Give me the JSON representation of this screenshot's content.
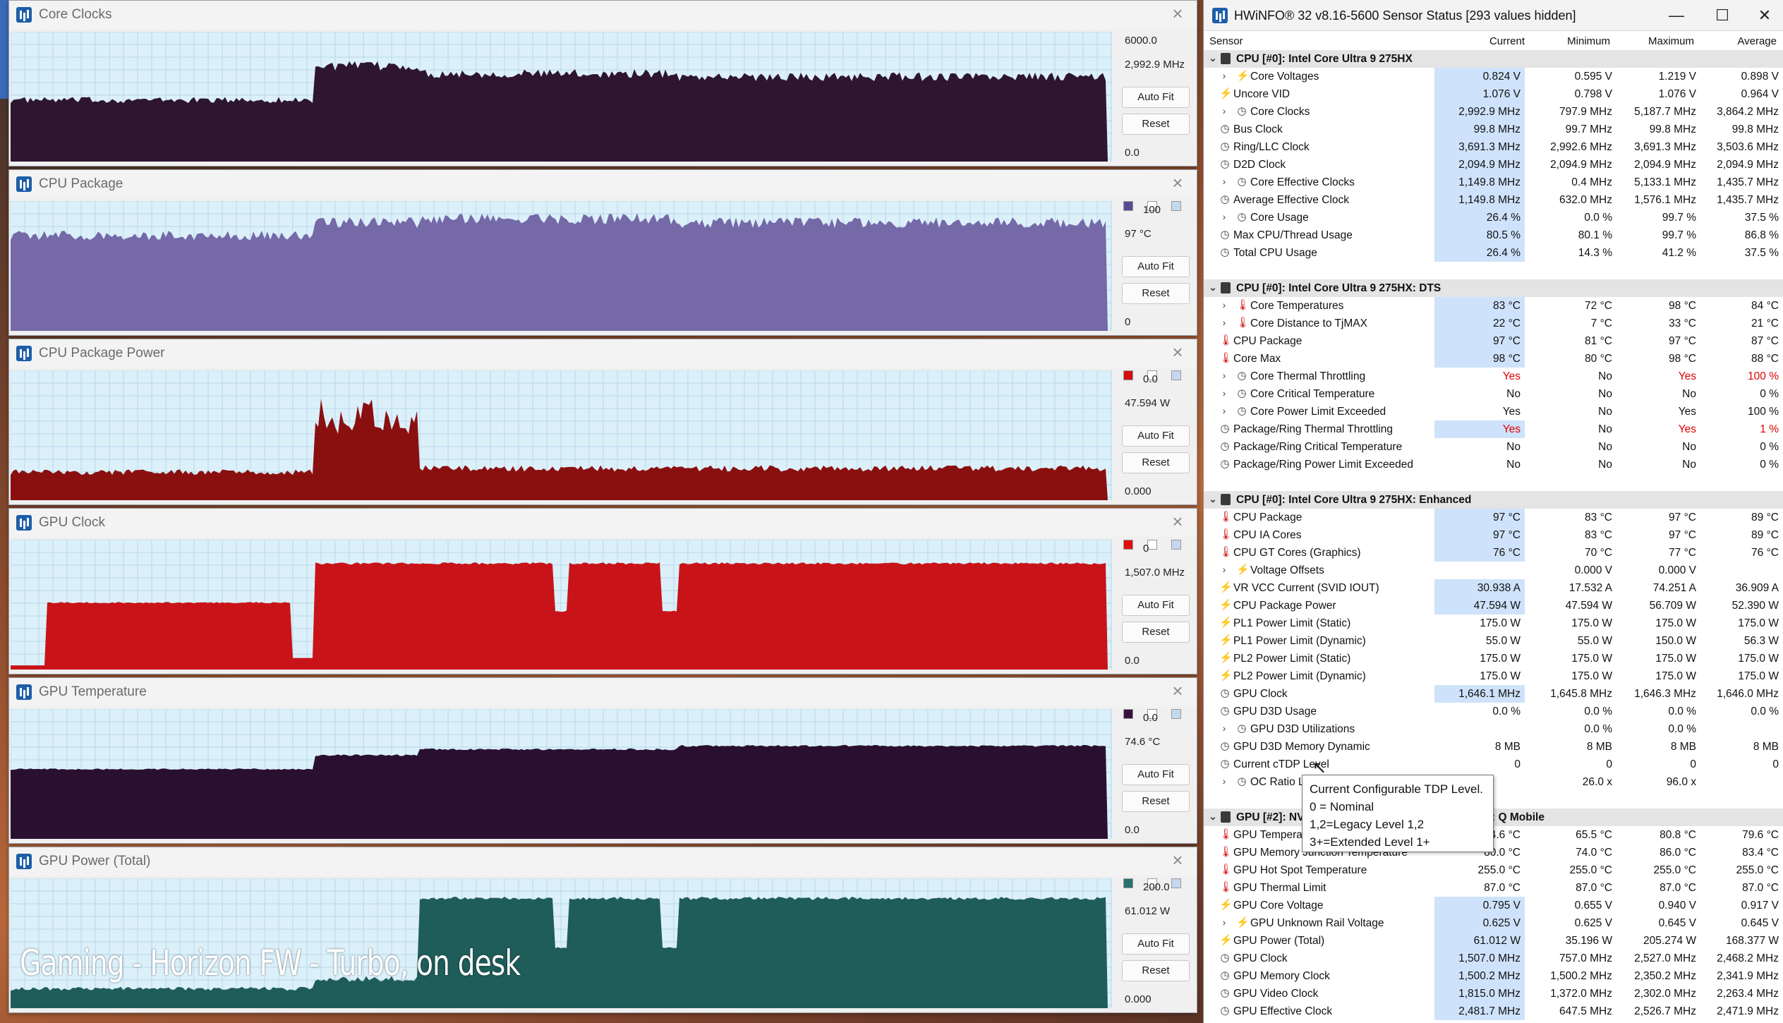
{
  "graphs": [
    {
      "title": "Core Clocks",
      "max": "6000.0",
      "current": "2,992.9 MHz",
      "min": "0.0",
      "auto_fit": "Auto Fit",
      "reset": "Reset",
      "color": "#2e1530",
      "sw": []
    },
    {
      "title": "CPU Package",
      "max": "100",
      "current": "97 °C",
      "min": "0",
      "auto_fit": "Auto Fit",
      "reset": "Reset",
      "color": "#7569a8",
      "sw": [
        "#5a4a90",
        "#ffffff",
        "#c6d8ef"
      ]
    },
    {
      "title": "CPU Package Power",
      "max": "0.0",
      "current": "47.594 W",
      "min": "0.000",
      "auto_fit": "Auto Fit",
      "reset": "Reset",
      "color": "#8a1010",
      "sw": [
        "#d01010",
        "#ffffff",
        "#c6d8ef"
      ]
    },
    {
      "title": "GPU Clock",
      "max": "0",
      "current": "1,507.0 MHz",
      "min": "0.0",
      "auto_fit": "Auto Fit",
      "reset": "Reset",
      "color": "#c81418",
      "sw": [
        "#e01010",
        "#ffffff",
        "#c6d8ef"
      ]
    },
    {
      "title": "GPU Temperature",
      "max": "0.0",
      "current": "74.6 °C",
      "min": "0.0",
      "auto_fit": "Auto Fit",
      "reset": "Reset",
      "color": "#2a1030",
      "sw": [
        "#3a1040",
        "#ffffff",
        "#c6d8ef"
      ]
    },
    {
      "title": "GPU Power (Total)",
      "max": "200.0",
      "current": "61.012 W",
      "min": "0.000",
      "auto_fit": "Auto Fit",
      "reset": "Reset",
      "color": "#1f5d5a",
      "sw": [
        "#2a7070",
        "#ffffff",
        "#c6d8ef"
      ]
    }
  ],
  "chart_data": [
    {
      "type": "area",
      "title": "Core Clocks",
      "ylim": [
        0,
        6000
      ],
      "segments_y": [
        2900,
        4500,
        4150,
        4000
      ]
    },
    {
      "type": "area",
      "title": "CPU Package",
      "ylim": [
        0,
        100
      ],
      "segments_y": [
        75,
        85,
        88,
        85
      ]
    },
    {
      "type": "area",
      "title": "CPU Package Power",
      "ylim": [
        0,
        100
      ],
      "segments_y": [
        22,
        58,
        25,
        25
      ]
    },
    {
      "type": "area",
      "title": "GPU Clock",
      "ylim": [
        0,
        2800
      ],
      "segments_y": [
        1450,
        2300,
        2300,
        2300
      ]
    },
    {
      "type": "area",
      "title": "GPU Temperature",
      "ylim": [
        0,
        100
      ],
      "segments_y": [
        60,
        72,
        77,
        80
      ]
    },
    {
      "type": "area",
      "title": "GPU Power (Total)",
      "ylim": [
        0,
        200
      ],
      "segments_y": [
        30,
        45,
        200,
        200
      ]
    }
  ],
  "hwinfo": {
    "title": "HWiNFO® 32 v8.16-5600 Sensor Status [293 values hidden]",
    "columns": {
      "sensor": "Sensor",
      "current": "Current",
      "minimum": "Minimum",
      "maximum": "Maximum",
      "average": "Average"
    },
    "rows": [
      {
        "t": "g",
        "label": "CPU [#0]: Intel Core Ultra 9 275HX"
      },
      {
        "t": "r",
        "exp": 1,
        "icon": "bolt",
        "label": "Core Voltages",
        "cur": "0.824 V",
        "min": "0.595 V",
        "max": "1.219 V",
        "avg": "0.898 V",
        "hl": 1
      },
      {
        "t": "r",
        "icon": "bolt",
        "label": "Uncore VID",
        "cur": "1.076 V",
        "min": "0.798 V",
        "max": "1.076 V",
        "avg": "0.964 V",
        "hl": 1
      },
      {
        "t": "r",
        "exp": 1,
        "icon": "clock",
        "label": "Core Clocks",
        "cur": "2,992.9 MHz",
        "min": "797.9 MHz",
        "max": "5,187.7 MHz",
        "avg": "3,864.2 MHz",
        "hl": 1
      },
      {
        "t": "r",
        "icon": "clock",
        "label": "Bus Clock",
        "cur": "99.8 MHz",
        "min": "99.7 MHz",
        "max": "99.8 MHz",
        "avg": "99.8 MHz",
        "hl": 1
      },
      {
        "t": "r",
        "icon": "clock",
        "label": "Ring/LLC Clock",
        "cur": "3,691.3 MHz",
        "min": "2,992.6 MHz",
        "max": "3,691.3 MHz",
        "avg": "3,503.6 MHz",
        "hl": 1
      },
      {
        "t": "r",
        "icon": "clock",
        "label": "D2D Clock",
        "cur": "2,094.9 MHz",
        "min": "2,094.9 MHz",
        "max": "2,094.9 MHz",
        "avg": "2,094.9 MHz",
        "hl": 1
      },
      {
        "t": "r",
        "exp": 1,
        "icon": "clock",
        "label": "Core Effective Clocks",
        "cur": "1,149.8 MHz",
        "min": "0.4 MHz",
        "max": "5,133.1 MHz",
        "avg": "1,435.7 MHz",
        "hl": 1
      },
      {
        "t": "r",
        "icon": "clock",
        "label": "Average Effective Clock",
        "cur": "1,149.8 MHz",
        "min": "632.0 MHz",
        "max": "1,576.1 MHz",
        "avg": "1,435.7 MHz",
        "hl": 1
      },
      {
        "t": "r",
        "exp": 1,
        "icon": "clock",
        "label": "Core Usage",
        "cur": "26.4 %",
        "min": "0.0 %",
        "max": "99.7 %",
        "avg": "37.5 %",
        "hl": 1
      },
      {
        "t": "r",
        "icon": "clock",
        "label": "Max CPU/Thread Usage",
        "cur": "80.5 %",
        "min": "80.1 %",
        "max": "99.7 %",
        "avg": "86.8 %",
        "hl": 1
      },
      {
        "t": "r",
        "icon": "clock",
        "label": "Total CPU Usage",
        "cur": "26.4 %",
        "min": "14.3 %",
        "max": "41.2 %",
        "avg": "37.5 %",
        "hl": 1
      },
      {
        "t": "s"
      },
      {
        "t": "g",
        "label": "CPU [#0]: Intel Core Ultra 9 275HX: DTS"
      },
      {
        "t": "r",
        "exp": 1,
        "icon": "therm",
        "label": "Core Temperatures",
        "cur": "83 °C",
        "min": "72 °C",
        "max": "98 °C",
        "avg": "84 °C",
        "hl": 1
      },
      {
        "t": "r",
        "exp": 1,
        "icon": "therm",
        "label": "Core Distance to TjMAX",
        "cur": "22 °C",
        "min": "7 °C",
        "max": "33 °C",
        "avg": "21 °C",
        "hl": 1
      },
      {
        "t": "r",
        "icon": "therm",
        "label": "CPU Package",
        "cur": "97 °C",
        "min": "81 °C",
        "max": "97 °C",
        "avg": "87 °C",
        "hl": 1
      },
      {
        "t": "r",
        "icon": "therm",
        "label": "Core Max",
        "cur": "98 °C",
        "min": "80 °C",
        "max": "98 °C",
        "avg": "88 °C",
        "hl": 1
      },
      {
        "t": "r",
        "exp": 1,
        "icon": "clock",
        "label": "Core Thermal Throttling",
        "cur": "Yes",
        "min": "No",
        "max": "Yes",
        "avg": "100 %",
        "red": 1
      },
      {
        "t": "r",
        "exp": 1,
        "icon": "clock",
        "label": "Core Critical Temperature",
        "cur": "No",
        "min": "No",
        "max": "No",
        "avg": "0 %"
      },
      {
        "t": "r",
        "exp": 1,
        "icon": "clock",
        "label": "Core Power Limit Exceeded",
        "cur": "Yes",
        "min": "No",
        "max": "Yes",
        "avg": "100 %"
      },
      {
        "t": "r",
        "icon": "clock",
        "label": "Package/Ring Thermal Throttling",
        "cur": "Yes",
        "min": "No",
        "max": "Yes",
        "avg": "1 %",
        "red": 1,
        "hl": 1
      },
      {
        "t": "r",
        "icon": "clock",
        "label": "Package/Ring Critical Temperature",
        "cur": "No",
        "min": "No",
        "max": "No",
        "avg": "0 %"
      },
      {
        "t": "r",
        "icon": "clock",
        "label": "Package/Ring Power Limit Exceeded",
        "cur": "No",
        "min": "No",
        "max": "No",
        "avg": "0 %"
      },
      {
        "t": "s"
      },
      {
        "t": "g",
        "label": "CPU [#0]: Intel Core Ultra 9 275HX: Enhanced"
      },
      {
        "t": "r",
        "icon": "therm",
        "label": "CPU Package",
        "cur": "97 °C",
        "min": "83 °C",
        "max": "97 °C",
        "avg": "89 °C",
        "hl": 1
      },
      {
        "t": "r",
        "icon": "therm",
        "label": "CPU IA Cores",
        "cur": "97 °C",
        "min": "83 °C",
        "max": "97 °C",
        "avg": "89 °C",
        "hl": 1
      },
      {
        "t": "r",
        "icon": "therm",
        "label": "CPU GT Cores (Graphics)",
        "cur": "76 °C",
        "min": "70 °C",
        "max": "77 °C",
        "avg": "76 °C",
        "hl": 1
      },
      {
        "t": "r",
        "exp": 1,
        "icon": "bolt",
        "label": "Voltage Offsets",
        "cur": "",
        "min": "0.000 V",
        "max": "0.000 V",
        "avg": ""
      },
      {
        "t": "r",
        "icon": "bolt",
        "label": "VR VCC Current (SVID IOUT)",
        "cur": "30.938 A",
        "min": "17.532 A",
        "max": "74.251 A",
        "avg": "36.909 A",
        "hl": 1
      },
      {
        "t": "r",
        "icon": "bolt",
        "label": "CPU Package Power",
        "cur": "47.594 W",
        "min": "47.594 W",
        "max": "56.709 W",
        "avg": "52.390 W",
        "hl": 1
      },
      {
        "t": "r",
        "icon": "bolt",
        "label": "PL1 Power Limit (Static)",
        "cur": "175.0 W",
        "min": "175.0 W",
        "max": "175.0 W",
        "avg": "175.0 W"
      },
      {
        "t": "r",
        "icon": "bolt",
        "label": "PL1 Power Limit (Dynamic)",
        "cur": "55.0 W",
        "min": "55.0 W",
        "max": "150.0 W",
        "avg": "56.3 W"
      },
      {
        "t": "r",
        "icon": "bolt",
        "label": "PL2 Power Limit (Static)",
        "cur": "175.0 W",
        "min": "175.0 W",
        "max": "175.0 W",
        "avg": "175.0 W"
      },
      {
        "t": "r",
        "icon": "bolt",
        "label": "PL2 Power Limit (Dynamic)",
        "cur": "175.0 W",
        "min": "175.0 W",
        "max": "175.0 W",
        "avg": "175.0 W"
      },
      {
        "t": "r",
        "icon": "clock",
        "label": "GPU Clock",
        "cur": "1,646.1 MHz",
        "min": "1,645.8 MHz",
        "max": "1,646.3 MHz",
        "avg": "1,646.0 MHz",
        "hl": 1
      },
      {
        "t": "r",
        "icon": "clock",
        "label": "GPU D3D Usage",
        "cur": "0.0 %",
        "min": "0.0 %",
        "max": "0.0 %",
        "avg": "0.0 %"
      },
      {
        "t": "r",
        "exp": 1,
        "icon": "clock",
        "label": "GPU D3D Utilizations",
        "cur": "",
        "min": "0.0 %",
        "max": "0.0 %",
        "avg": ""
      },
      {
        "t": "r",
        "icon": "clock",
        "label": "GPU D3D Memory Dynamic",
        "cur": "8 MB",
        "min": "8 MB",
        "max": "8 MB",
        "avg": "8 MB"
      },
      {
        "t": "r",
        "icon": "clock",
        "label": "Current cTDP Level",
        "cur": "0",
        "min": "0",
        "max": "0",
        "avg": "0"
      },
      {
        "t": "r",
        "exp": 1,
        "icon": "clock",
        "label": "OC Ratio Limits",
        "cur": "",
        "min": "26.0 x",
        "max": "96.0 x",
        "avg": ""
      },
      {
        "t": "s"
      },
      {
        "t": "g",
        "label": "GPU [#2]: NVIDIA GeForce RTX 5090 Laptop GPU: Q Mobile"
      },
      {
        "t": "r",
        "icon": "therm",
        "label": "GPU Temperature",
        "cur": "74.6 °C",
        "min": "65.5 °C",
        "max": "80.8 °C",
        "avg": "79.6 °C"
      },
      {
        "t": "r",
        "icon": "therm",
        "label": "GPU Memory Junction Temperature",
        "cur": "80.0 °C",
        "min": "74.0 °C",
        "max": "86.0 °C",
        "avg": "83.4 °C"
      },
      {
        "t": "r",
        "icon": "therm",
        "label": "GPU Hot Spot Temperature",
        "cur": "255.0 °C",
        "min": "255.0 °C",
        "max": "255.0 °C",
        "avg": "255.0 °C"
      },
      {
        "t": "r",
        "icon": "therm",
        "label": "GPU Thermal Limit",
        "cur": "87.0 °C",
        "min": "87.0 °C",
        "max": "87.0 °C",
        "avg": "87.0 °C"
      },
      {
        "t": "r",
        "icon": "bolt",
        "label": "GPU Core Voltage",
        "cur": "0.795 V",
        "min": "0.655 V",
        "max": "0.940 V",
        "avg": "0.917 V",
        "hl": 1
      },
      {
        "t": "r",
        "exp": 1,
        "icon": "bolt",
        "label": "GPU Unknown Rail Voltage",
        "cur": "0.625 V",
        "min": "0.625 V",
        "max": "0.645 V",
        "avg": "0.645 V",
        "hl": 1
      },
      {
        "t": "r",
        "icon": "bolt",
        "label": "GPU Power (Total)",
        "cur": "61.012 W",
        "min": "35.196 W",
        "max": "205.274 W",
        "avg": "168.377 W",
        "hl": 1
      },
      {
        "t": "r",
        "icon": "clock",
        "label": "GPU Clock",
        "cur": "1,507.0 MHz",
        "min": "757.0 MHz",
        "max": "2,527.0 MHz",
        "avg": "2,468.2 MHz",
        "hl": 1
      },
      {
        "t": "r",
        "icon": "clock",
        "label": "GPU Memory Clock",
        "cur": "1,500.2 MHz",
        "min": "1,500.2 MHz",
        "max": "2,350.2 MHz",
        "avg": "2,341.9 MHz",
        "hl": 1
      },
      {
        "t": "r",
        "icon": "clock",
        "label": "GPU Video Clock",
        "cur": "1,815.0 MHz",
        "min": "1,372.0 MHz",
        "max": "2,302.0 MHz",
        "avg": "2,263.4 MHz",
        "hl": 1
      },
      {
        "t": "r",
        "icon": "clock",
        "label": "GPU Effective Clock",
        "cur": "2,481.7 MHz",
        "min": "647.5 MHz",
        "max": "2,526.7 MHz",
        "avg": "2,471.9 MHz",
        "hl": 1
      }
    ]
  },
  "tooltip": {
    "lines": [
      "Current Configurable TDP Level.",
      "0 = Nominal",
      "1,2=Legacy Level 1,2",
      "3+=Extended Level 1+"
    ]
  },
  "caption": "Gaming - Horizon FW - Turbo, on desk",
  "icons": {
    "minimize": "—",
    "maximize": "☐",
    "close": "✕",
    "graph_close": "×",
    "expand": "›",
    "collapse": "⌄",
    "bolt": "⚡",
    "therm": "🌡",
    "clock": "◷"
  }
}
